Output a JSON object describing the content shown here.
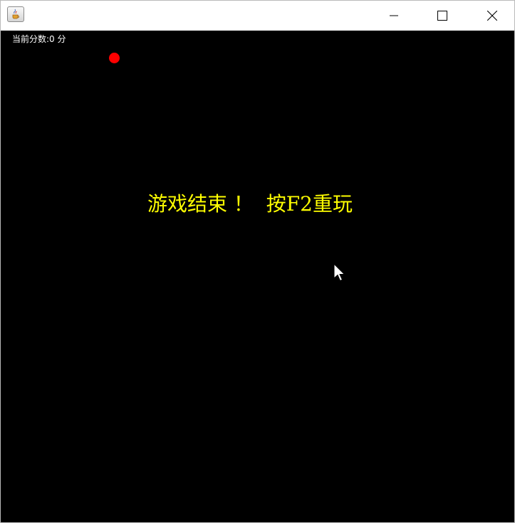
{
  "window": {
    "icon": "java-cup-icon",
    "controls": {
      "minimize_icon": "minimize-icon",
      "maximize_icon": "maximize-icon",
      "close_icon": "close-icon"
    }
  },
  "game": {
    "score_label": "当前分数:",
    "score_value": "0",
    "score_unit": "分",
    "game_over_text": "游戏结束 ！  按F2重玩",
    "colors": {
      "background": "#000000",
      "score_text": "#ffffff",
      "game_over_text": "#ffff00",
      "food": "#ff0000"
    }
  }
}
